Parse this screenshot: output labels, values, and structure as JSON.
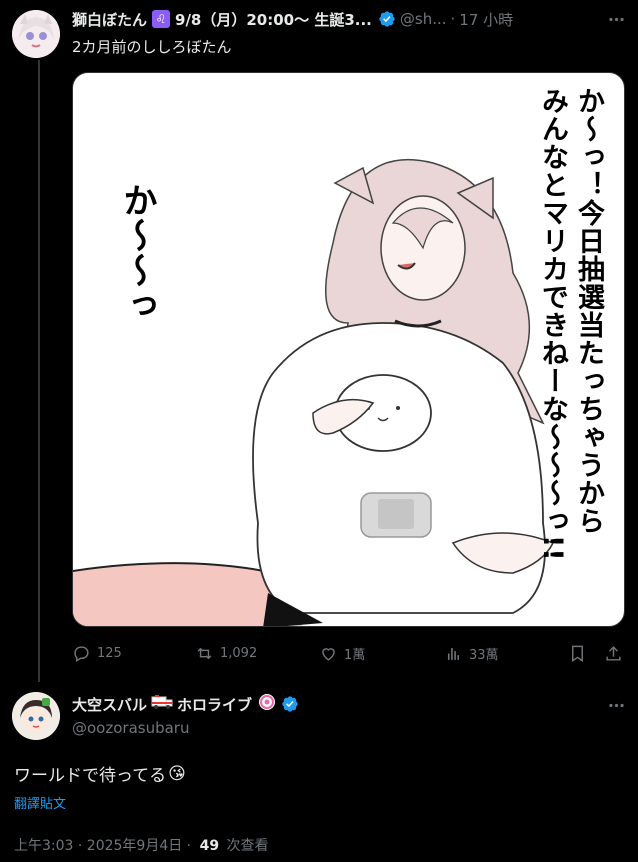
{
  "tweet1": {
    "display_name": "獅白ぼたん",
    "emoji_badge": "♌",
    "name_suffix": "9/8（月）20:00～ 生誕3...",
    "handle": "@sh...",
    "separator": "·",
    "time": "17 小時",
    "text": "2カ月前のししろぼたん",
    "image": {
      "left_text": "か〜〜っ",
      "right_col1": "か〜っ！今日抽選当たっちゃうから",
      "right_col2": "みんなとマリカできねーな〜〜〜っ!!"
    },
    "replies": "125",
    "reposts": "1,092",
    "likes": "1萬",
    "views": "33萬"
  },
  "tweet2": {
    "display_name": "大空スバル",
    "name_suffix": "ホロライブ",
    "handle": "@oozorasubaru",
    "text": "ワールドで待ってる",
    "text_emoji": "😘",
    "translate_label": "翻譯貼文",
    "time_stamp": "上午3:03 · 2025年9月4日 ·",
    "view_count": "49",
    "view_label": "次查看"
  },
  "colors": {
    "accent": "#1d9bf0",
    "muted": "#71767b",
    "text": "#e7e9ea",
    "leo_bg": "#8b5cf6"
  },
  "icons": [
    "reply-icon",
    "repost-icon",
    "like-icon",
    "views-icon",
    "bookmark-icon",
    "share-icon",
    "more-icon",
    "verified-icon"
  ]
}
